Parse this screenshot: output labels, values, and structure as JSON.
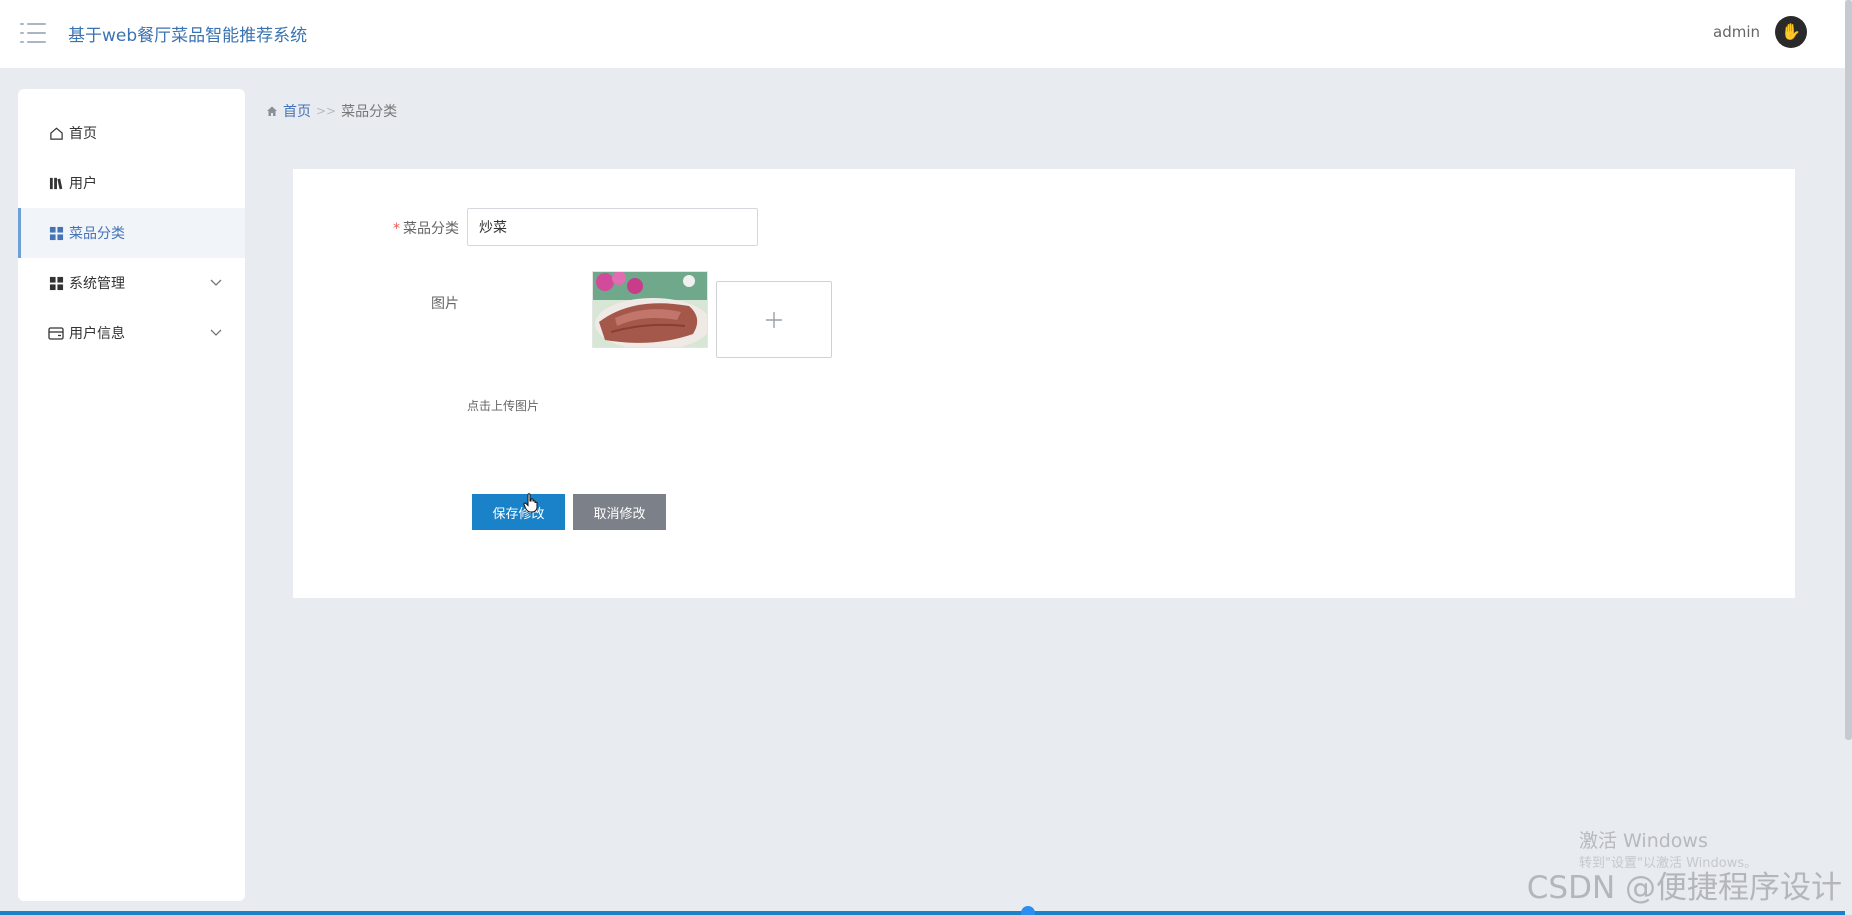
{
  "app": {
    "title": "基于web餐厅菜品智能推荐系统"
  },
  "header": {
    "username": "admin",
    "avatar_glyph": "✋"
  },
  "sidebar": {
    "items": [
      {
        "label": "首页",
        "icon": "home-icon"
      },
      {
        "label": "用户",
        "icon": "users-icon"
      },
      {
        "label": "菜品分类",
        "icon": "grid-icon",
        "active": true
      },
      {
        "label": "系统管理",
        "icon": "grid-icon",
        "expandable": true
      },
      {
        "label": "用户信息",
        "icon": "card-icon",
        "expandable": true
      }
    ]
  },
  "breadcrumb": {
    "home": "首页",
    "separator": ">>",
    "current": "菜品分类"
  },
  "form": {
    "category_label": "菜品分类",
    "category_value": "炒菜",
    "image_label": "图片",
    "upload_hint": "点击上传图片",
    "save_button": "保存修改",
    "cancel_button": "取消修改"
  },
  "overlay": {
    "activation_title": "激活 Windows",
    "activation_sub": "转到\"设置\"以激活 Windows。",
    "watermark": "CSDN @便捷程序设计"
  },
  "colors": {
    "accent": "#1a82c8",
    "title_blue": "#3a73b1",
    "sidebar_active_bg": "#f1f4f8",
    "page_bg": "#e8ebf0"
  }
}
